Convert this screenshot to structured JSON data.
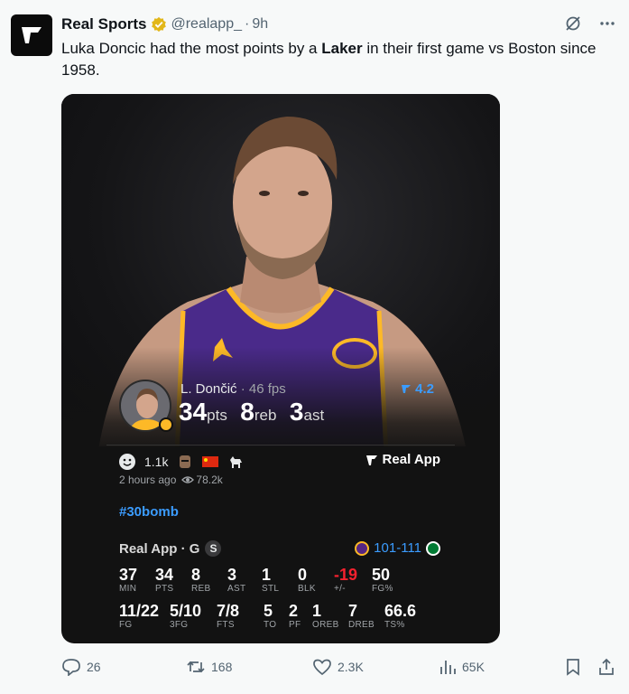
{
  "author": {
    "name": "Real Sports",
    "handle": "@realapp_",
    "separator": "·",
    "time": "9h",
    "avatar_icon": "real-app-logo-icon"
  },
  "tweet": {
    "text_before": "Luka Doncic had the most points by a ",
    "text_bold": "Laker",
    "text_after": " in their first game vs Boston since 1958."
  },
  "card": {
    "player": {
      "name": "L. Dončić",
      "fps": " · 46 fps",
      "rating": "4.2",
      "stats": [
        {
          "num": "34",
          "unit": "pts"
        },
        {
          "num": "8",
          "unit": "reb"
        },
        {
          "num": "3",
          "unit": "ast"
        }
      ]
    },
    "reactions": {
      "count": "1.1k"
    },
    "brand": "Real App",
    "meta": {
      "posted": "2 hours ago",
      "views": "78.2k"
    },
    "hashtag": "#30bomb",
    "box": {
      "title": "Real App · G",
      "badge": "S",
      "score": "101-111",
      "row1": [
        {
          "v": "37",
          "l": "MIN"
        },
        {
          "v": "34",
          "l": "PTS"
        },
        {
          "v": "8",
          "l": "REB"
        },
        {
          "v": "3",
          "l": "AST"
        },
        {
          "v": "1",
          "l": "STL"
        },
        {
          "v": "0",
          "l": "BLK"
        },
        {
          "v": "-19",
          "l": "+/-"
        },
        {
          "v": "50",
          "l": "FG%"
        }
      ],
      "row2": [
        {
          "v": "11/22",
          "l": "FG"
        },
        {
          "v": "5/10",
          "l": "3FG"
        },
        {
          "v": "7/8",
          "l": "FTS"
        },
        {
          "v": "5",
          "l": "TO"
        },
        {
          "v": "2",
          "l": "PF"
        },
        {
          "v": "1",
          "l": "OREB"
        },
        {
          "v": "7",
          "l": "DREB"
        },
        {
          "v": "66.6",
          "l": "TS%"
        }
      ]
    }
  },
  "actions": {
    "replies": "26",
    "reposts": "168",
    "likes": "2.3K",
    "views": "65K"
  },
  "colors": {
    "accent": "#3b9cff",
    "negative": "#f4212e",
    "lakers_gold": "#fdb927",
    "lakers_purple": "#552583",
    "celtics_green": "#007a33",
    "verified_gold": "#e2b719"
  }
}
